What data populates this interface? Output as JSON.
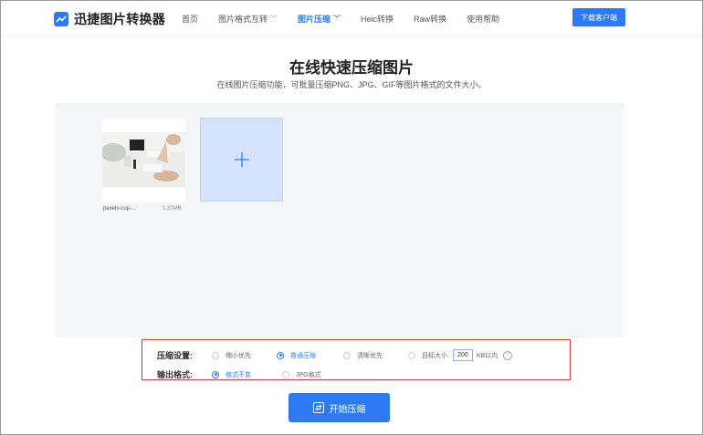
{
  "header": {
    "logo_text": "迅捷图片转换器",
    "nav": [
      {
        "label": "首页",
        "dropdown": false,
        "active": false
      },
      {
        "label": "图片格式互转",
        "dropdown": true,
        "active": false
      },
      {
        "label": "图片压缩",
        "dropdown": true,
        "active": true
      },
      {
        "label": "Heic转换",
        "dropdown": false,
        "active": false
      },
      {
        "label": "Raw转换",
        "dropdown": false,
        "active": false
      },
      {
        "label": "使用帮助",
        "dropdown": false,
        "active": false
      }
    ],
    "download_label": "下载客户端"
  },
  "hero": {
    "title": "在线快速压缩图片",
    "subtitle": "在线图片压缩功能，可批量压缩PNG、JPG、GIF等图片格式的文件大小。"
  },
  "upload": {
    "file": {
      "name": "pexels-cup-...",
      "size": "1.37MB"
    },
    "add_symbol": "+"
  },
  "settings": {
    "compress_label": "压缩设置:",
    "compress_options": [
      {
        "label": "缩小优先",
        "selected": false
      },
      {
        "label": "普通压缩",
        "selected": true
      },
      {
        "label": "清晰优先",
        "selected": false
      },
      {
        "label": "目标大小:",
        "selected": false
      }
    ],
    "target_value": "200",
    "target_unit": "KB以内",
    "info_symbol": "i",
    "format_label": "输出格式:",
    "format_options": [
      {
        "label": "格式不变",
        "selected": true
      },
      {
        "label": "JPG格式",
        "selected": false
      }
    ]
  },
  "start_label": "开始压缩",
  "colors": {
    "accent": "#2d7bf4",
    "highlight_border": "#d9363e"
  }
}
